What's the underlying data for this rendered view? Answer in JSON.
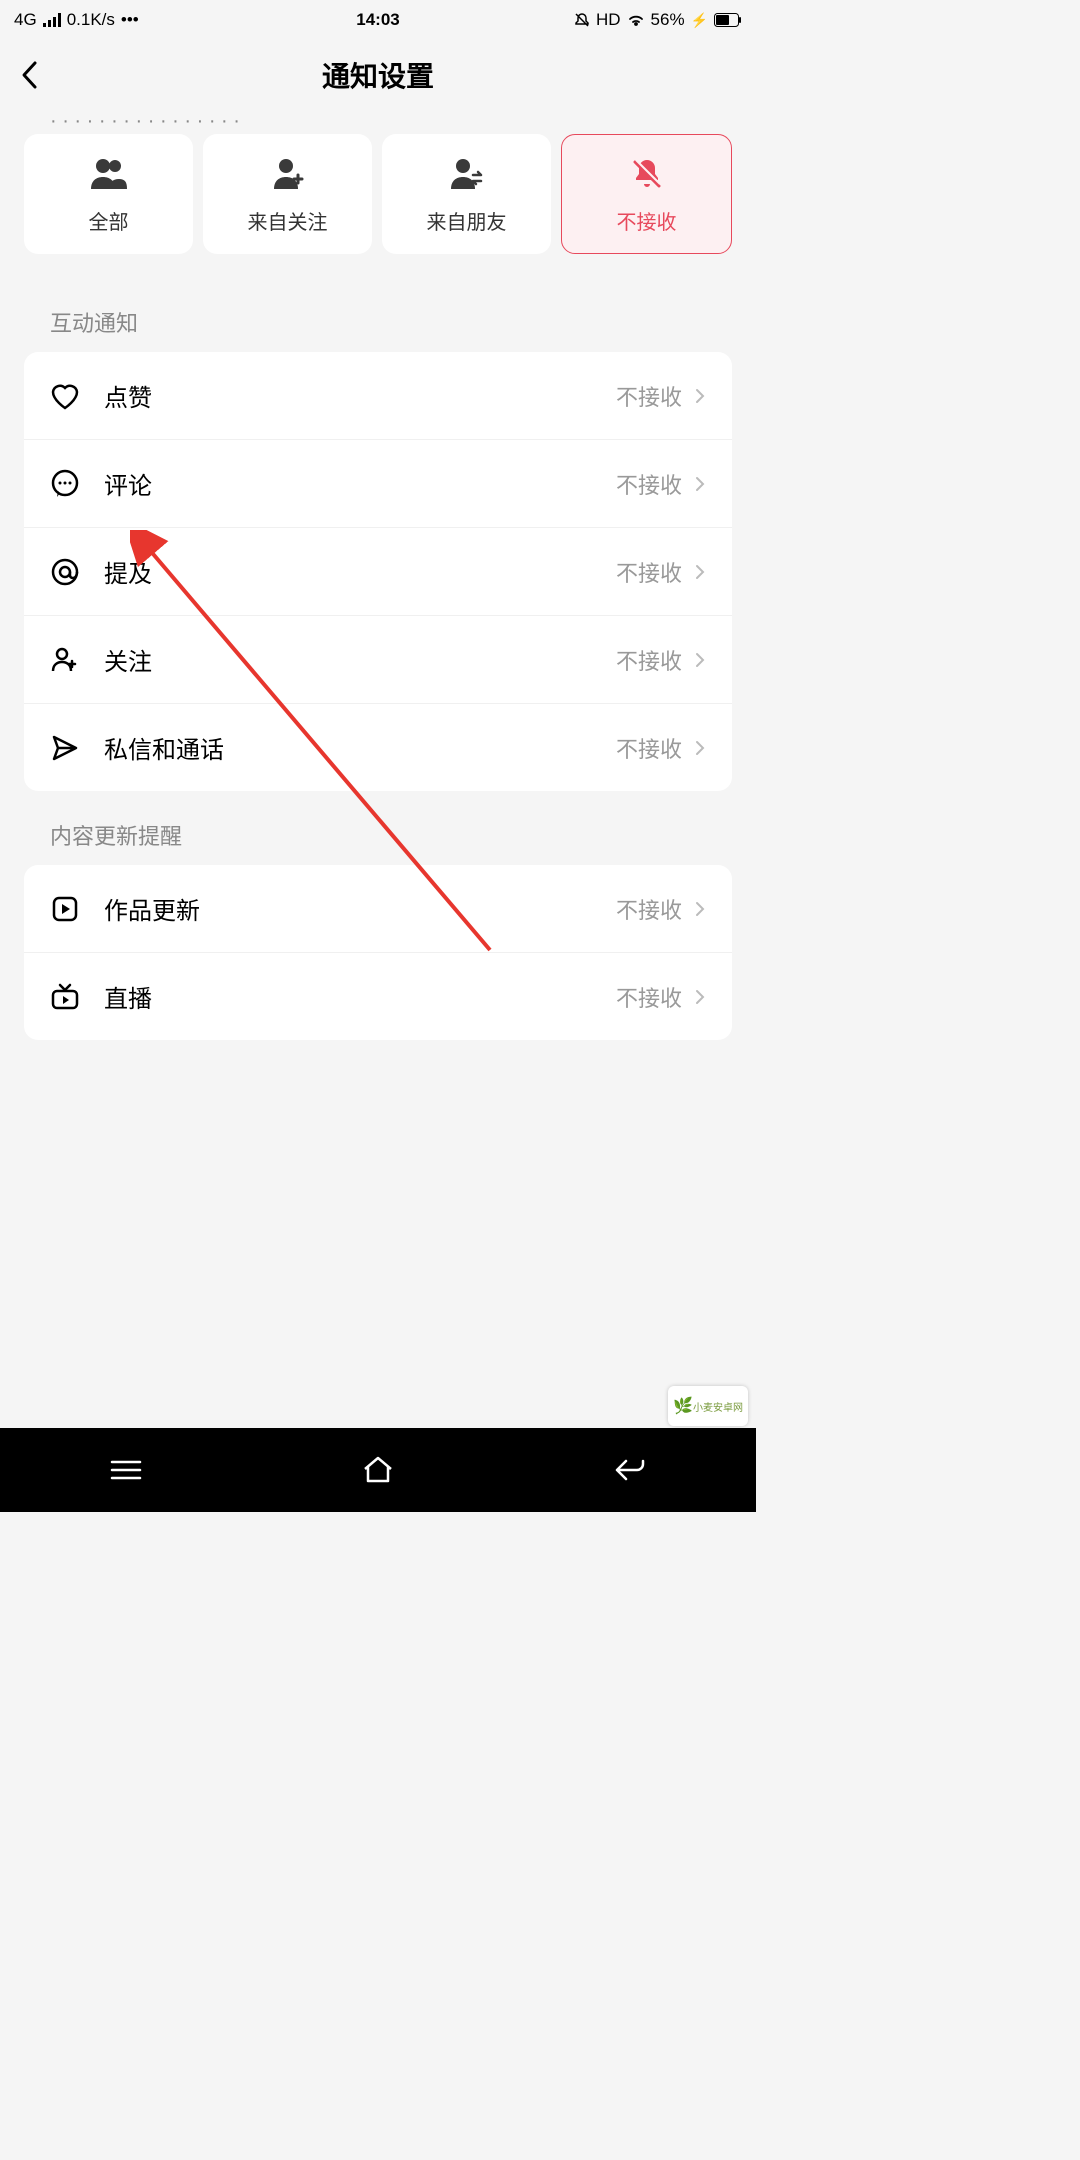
{
  "status": {
    "network": "4G",
    "speed": "0.1K/s",
    "dots": "•••",
    "time": "14:03",
    "hd": "HD",
    "battery_pct": "56%"
  },
  "header": {
    "title": "通知设置"
  },
  "filters": [
    {
      "label": "全部",
      "icon": "people-icon"
    },
    {
      "label": "来自关注",
      "icon": "person-plus-icon"
    },
    {
      "label": "来自朋友",
      "icon": "person-swap-icon"
    },
    {
      "label": "不接收",
      "icon": "bell-off-icon",
      "active": true
    }
  ],
  "sections": [
    {
      "title": "互动通知",
      "items": [
        {
          "icon": "heart-icon",
          "label": "点赞",
          "value": "不接收"
        },
        {
          "icon": "comment-icon",
          "label": "评论",
          "value": "不接收"
        },
        {
          "icon": "at-icon",
          "label": "提及",
          "value": "不接收"
        },
        {
          "icon": "follow-icon",
          "label": "关注",
          "value": "不接收"
        },
        {
          "icon": "send-icon",
          "label": "私信和通话",
          "value": "不接收"
        }
      ]
    },
    {
      "title": "内容更新提醒",
      "items": [
        {
          "icon": "play-box-icon",
          "label": "作品更新",
          "value": "不接收"
        },
        {
          "icon": "tv-icon",
          "label": "直播",
          "value": "不接收"
        }
      ]
    }
  ],
  "watermark": "小麦安卓网"
}
